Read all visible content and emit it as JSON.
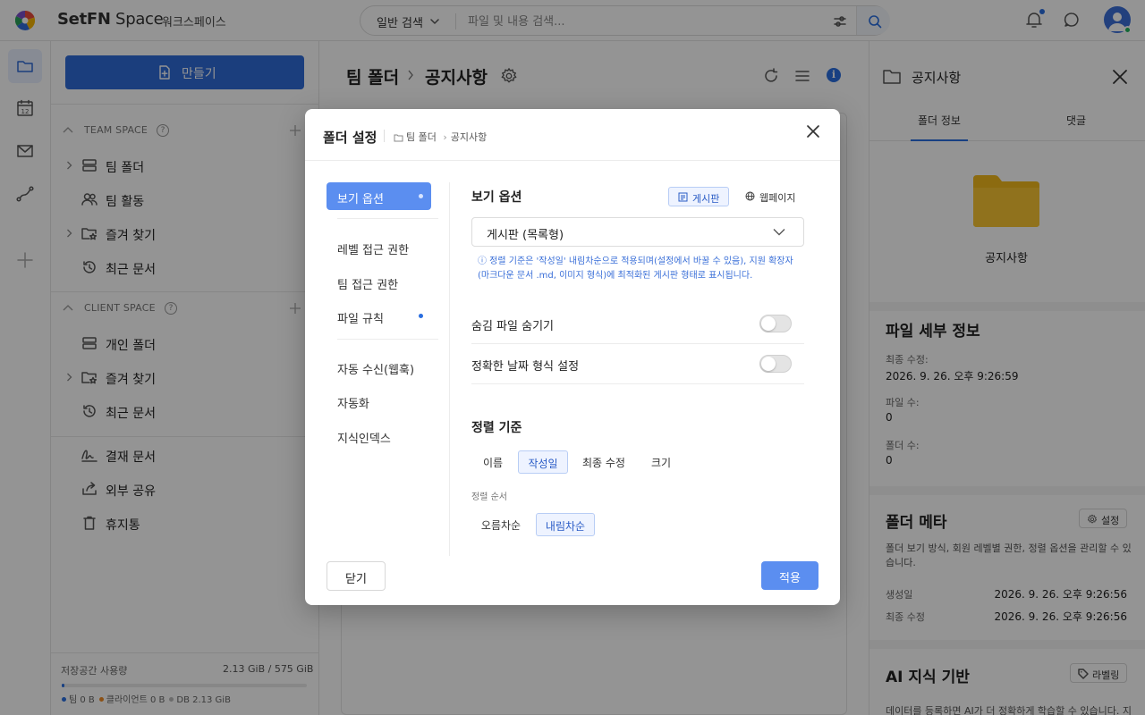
{
  "topbar": {
    "brand_a": "SetFN",
    "brand_b": " Space",
    "workspace": "워크스페이스",
    "search_scope": "일반 검색",
    "search_placeholder": "파일 및 내용 검색..."
  },
  "sidebar": {
    "create_label": "만들기",
    "team_space": {
      "title": "TEAM SPACE",
      "items": [
        {
          "label": "팀 폴더",
          "icon": "stack-icon",
          "expandable": true
        },
        {
          "label": "팀 활동",
          "icon": "people-icon",
          "expandable": false
        },
        {
          "label": "즐겨 찾기",
          "icon": "star-folder-icon",
          "expandable": true
        },
        {
          "label": "최근 문서",
          "icon": "history-icon",
          "expandable": false
        }
      ]
    },
    "client_space": {
      "title": "CLIENT SPACE",
      "items": [
        {
          "label": "개인 폴더",
          "icon": "stack-icon",
          "expandable": false
        },
        {
          "label": "즐겨 찾기",
          "icon": "star-folder-icon",
          "expandable": true
        },
        {
          "label": "최근 문서",
          "icon": "history-icon",
          "expandable": false
        }
      ]
    },
    "extra_items": [
      {
        "label": "결재 문서",
        "icon": "signature-icon"
      },
      {
        "label": "외부 공유",
        "icon": "share-icon"
      },
      {
        "label": "휴지통",
        "icon": "trash-icon"
      }
    ],
    "storage": {
      "label": "저장공간 사용량",
      "value": "2.13 GiB / 575 GiB",
      "used_fraction": 0.0037,
      "legend": [
        {
          "label": "팀 0 B",
          "color": "#2a6ee0"
        },
        {
          "label": "클라이언트 0 B",
          "color": "#f08a24"
        },
        {
          "label": "DB 2.13 GiB",
          "color": "#bbbbbb"
        }
      ]
    }
  },
  "main": {
    "breadcrumb": [
      "팀 폴더",
      "공지사항"
    ]
  },
  "right_panel": {
    "title": "공지사항",
    "tabs": [
      "폴더 정보",
      "댓글"
    ],
    "folder_name": "공지사항",
    "file_details": {
      "heading": "파일 세부 정보",
      "last_modified_label": "최종 수정:",
      "last_modified": "2026. 9. 26. 오후 9:26:59",
      "file_count_label": "파일 수:",
      "file_count": "0",
      "folder_count_label": "폴더 수:",
      "folder_count": "0"
    },
    "folder_meta": {
      "heading": "폴더 메타",
      "settings_label": "설정",
      "description": "폴더 보기 방식, 회원 레벨별 권한, 정렬 옵션을 관리할 수 있습니다.",
      "created_label": "생성일",
      "created": "2026. 9. 26. 오후 9:26:56",
      "modified_label": "최종 수정",
      "modified": "2026. 9. 26. 오후 9:26:56"
    },
    "ai": {
      "heading": "AI 지식 기반",
      "label_btn": "라벨링",
      "description": "데이터를 등록하면 AI가 더 정확하게 학습할 수 있습니다. 지"
    }
  },
  "modal": {
    "title": "폴더 설정",
    "crumb": [
      "팀 폴더",
      "공지사항"
    ],
    "nav": [
      {
        "label": "보기 옵션",
        "dot": true,
        "active": true
      },
      {
        "label": "레벨 접근 권한",
        "dot": false
      },
      {
        "label": "팀 접근 권한",
        "dot": false
      },
      {
        "label": "파일 규칙",
        "dot": true
      },
      {
        "label": "자동 수신(웹훅)",
        "dot": false
      },
      {
        "label": "자동화",
        "dot": false
      },
      {
        "label": "지식인덱스",
        "dot": false
      }
    ],
    "view_options": {
      "title": "보기 옵션",
      "mode_board": "게시판",
      "mode_web": "웹페이지",
      "select_value": "게시판 (목록형)",
      "note": "ⓘ  정렬 기준은 '작성일' 내림차순으로 적용되며(설정에서 바꿀 수 있음), 지원 확장자(마크다운 문서 .md, 이미지 형식)에 최적화된 게시판 형태로 표시됩니다.",
      "toggles": [
        {
          "label": "숨김 파일 숨기기",
          "on": false
        },
        {
          "label": "정확한 날짜 형식 설정",
          "on": false
        }
      ]
    },
    "sort": {
      "title": "정렬 기준",
      "options": [
        "이름",
        "작성일",
        "최종 수정",
        "크기"
      ],
      "selected": "작성일",
      "order_label": "정렬 순서",
      "orders": [
        "오름차순",
        "내림차순"
      ],
      "selected_order": "내림차순"
    },
    "close_label": "닫기",
    "apply_label": "적용"
  }
}
